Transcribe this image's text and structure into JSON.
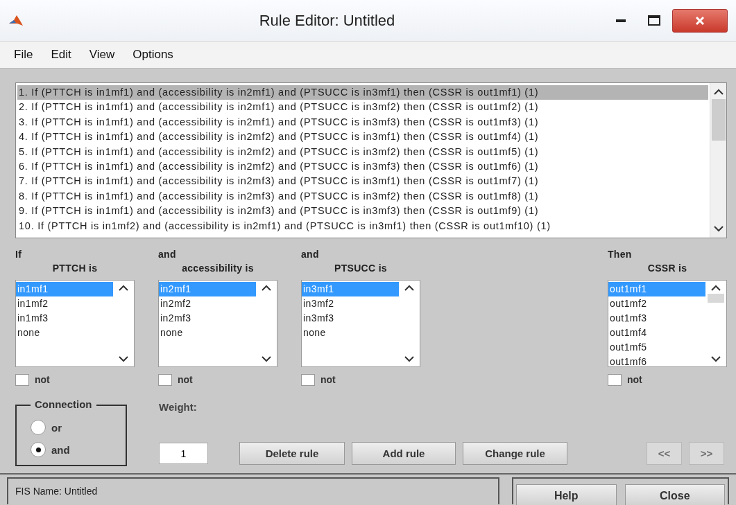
{
  "window": {
    "title": "Rule Editor: Untitled"
  },
  "menu": [
    "File",
    "Edit",
    "View",
    "Options"
  ],
  "rules": [
    {
      "text": "1. If (PTTCH is in1mf1) and (accessibility is in2mf1) and (PTSUCC is in3mf1) then (CSSR is out1mf1) (1)",
      "selected": true
    },
    {
      "text": "2. If (PTTCH is in1mf1) and (accessibility is in2mf1) and (PTSUCC is in3mf2) then (CSSR is out1mf2) (1)",
      "selected": false
    },
    {
      "text": "3. If (PTTCH is in1mf1) and (accessibility is in2mf1) and (PTSUCC is in3mf3) then (CSSR is out1mf3) (1)",
      "selected": false
    },
    {
      "text": "4. If (PTTCH is in1mf1) and (accessibility is in2mf2) and (PTSUCC is in3mf1) then (CSSR is out1mf4) (1)",
      "selected": false
    },
    {
      "text": "5. If (PTTCH is in1mf1) and (accessibility is in2mf2) and (PTSUCC is in3mf2) then (CSSR is out1mf5) (1)",
      "selected": false
    },
    {
      "text": "6. If (PTTCH is in1mf1) and (accessibility is in2mf2) and (PTSUCC is in3mf3) then (CSSR is out1mf6) (1)",
      "selected": false
    },
    {
      "text": "7. If (PTTCH is in1mf1) and (accessibility is in2mf3) and (PTSUCC is in3mf1) then (CSSR is out1mf7) (1)",
      "selected": false
    },
    {
      "text": "8. If (PTTCH is in1mf1) and (accessibility is in2mf3) and (PTSUCC is in3mf2) then (CSSR is out1mf8) (1)",
      "selected": false
    },
    {
      "text": "9. If (PTTCH is in1mf1) and (accessibility is in2mf3) and (PTSUCC is in3mf3) then (CSSR is out1mf9) (1)",
      "selected": false
    },
    {
      "text": "10. If (PTTCH is in1mf2) and (accessibility is in2mf1) and (PTSUCC is in3mf1) then (CSSR is out1mf10) (1)",
      "selected": false
    }
  ],
  "columns": [
    {
      "connective": "If",
      "label": "PTTCH is",
      "not": false,
      "items": [
        {
          "label": "in1mf1",
          "selected": true
        },
        {
          "label": "in1mf2",
          "selected": false
        },
        {
          "label": "in1mf3",
          "selected": false
        },
        {
          "label": "none",
          "selected": false
        }
      ],
      "not_label": "not"
    },
    {
      "connective": "and",
      "label": "accessibility is",
      "not": false,
      "items": [
        {
          "label": "in2mf1",
          "selected": true
        },
        {
          "label": "in2mf2",
          "selected": false
        },
        {
          "label": "in2mf3",
          "selected": false
        },
        {
          "label": "none",
          "selected": false
        }
      ],
      "not_label": "not"
    },
    {
      "connective": "and",
      "label": "PTSUCC is",
      "not": false,
      "items": [
        {
          "label": "in3mf1",
          "selected": true
        },
        {
          "label": "in3mf2",
          "selected": false
        },
        {
          "label": "in3mf3",
          "selected": false
        },
        {
          "label": "none",
          "selected": false
        }
      ],
      "not_label": "not"
    },
    {
      "connective": "Then",
      "label": "CSSR is",
      "not": false,
      "items": [
        {
          "label": "out1mf1",
          "selected": true
        },
        {
          "label": "out1mf2",
          "selected": false
        },
        {
          "label": "out1mf3",
          "selected": false
        },
        {
          "label": "out1mf4",
          "selected": false
        },
        {
          "label": "out1mf5",
          "selected": false
        },
        {
          "label": "out1mf6",
          "selected": false
        }
      ],
      "not_label": "not"
    }
  ],
  "connection": {
    "title": "Connection",
    "options": [
      {
        "label": "or",
        "selected": false
      },
      {
        "label": "and",
        "selected": true
      }
    ]
  },
  "weight": {
    "label": "Weight:",
    "value": "1"
  },
  "buttons": [
    {
      "label": "Delete rule",
      "disabled": false
    },
    {
      "label": "Add rule",
      "disabled": false
    },
    {
      "label": "Change rule",
      "disabled": false
    },
    {
      "label": "<<",
      "disabled": true
    },
    {
      "label": ">>",
      "disabled": true
    }
  ],
  "status": {
    "text": "FIS Name: Untitled"
  },
  "footer_buttons": [
    "Help",
    "Close"
  ]
}
